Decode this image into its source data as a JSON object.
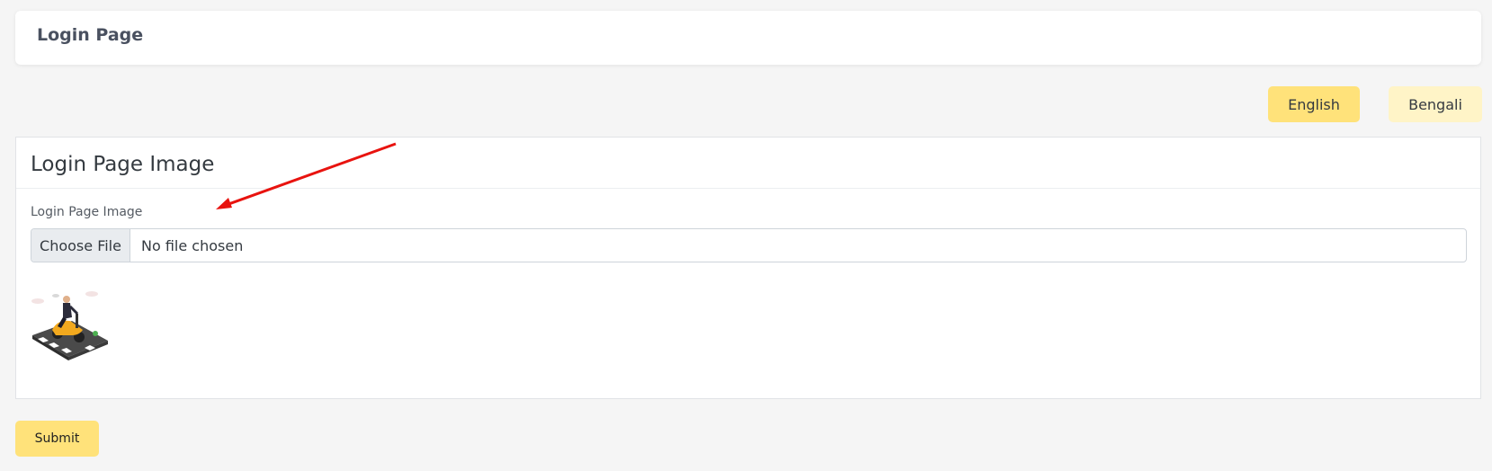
{
  "header": {
    "title": "Login Page"
  },
  "language_switcher": {
    "options": [
      {
        "label": "English",
        "active": true
      },
      {
        "label": "Bengali",
        "active": false
      }
    ],
    "active_color": "#ffe27a",
    "inactive_color": "#fff4c7"
  },
  "form_card": {
    "title": "Login Page Image",
    "field_label": "Login Page Image",
    "file_input": {
      "button_label": "Choose File",
      "status_text": "No file chosen"
    },
    "preview_image": {
      "icon": "scooter-rider-illustration"
    }
  },
  "annotation": {
    "icon": "red-arrow",
    "color": "#e8130f"
  },
  "submit": {
    "label": "Submit",
    "color": "#ffe27a"
  }
}
